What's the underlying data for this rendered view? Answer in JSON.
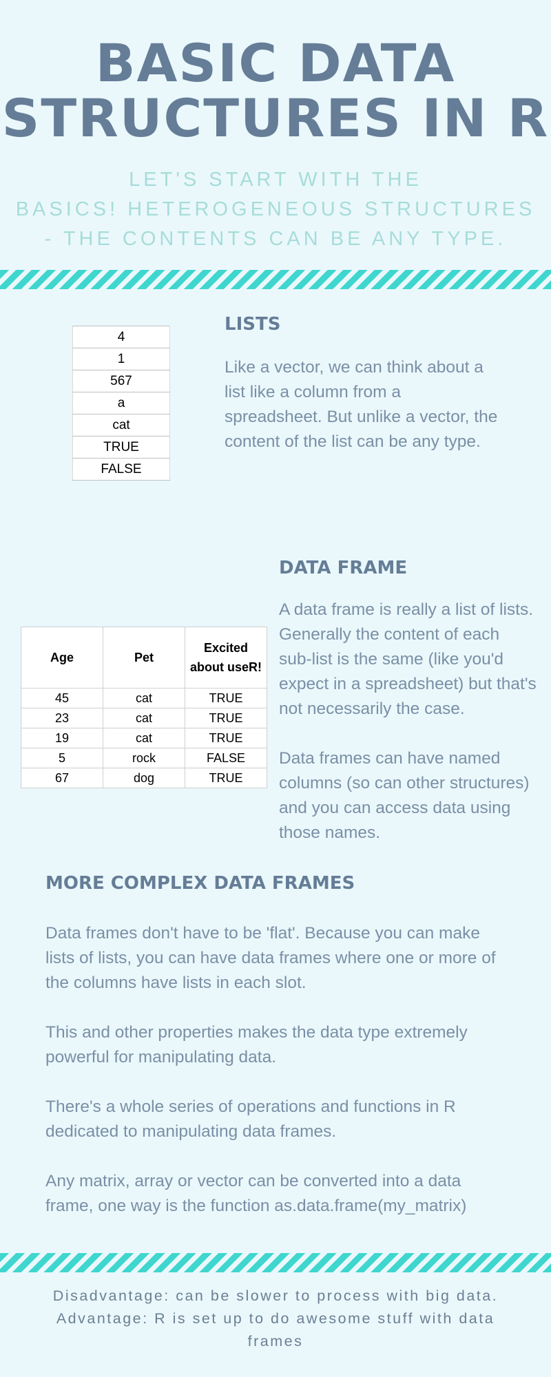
{
  "header": {
    "title_line1": "BASIC DATA",
    "title_line2": "STRUCTURES IN R",
    "subtitle_line1": "LET'S START WITH THE",
    "subtitle_line2": "BASICS! HETEROGENEOUS STRUCTURES",
    "subtitle_line3": "- THE CONTENTS CAN BE ANY TYPE."
  },
  "lists": {
    "heading": "LISTS",
    "table_values": [
      "4",
      "1",
      "567",
      "a",
      "cat",
      "TRUE",
      "FALSE"
    ],
    "text_lines": [
      "Like a vector, we can think about a",
      "list like a column from a",
      "spreadsheet. But unlike a vector, the",
      "content of the list can be any type."
    ]
  },
  "data_frame": {
    "heading": "DATA FRAME",
    "table_headers": [
      "Age",
      "Pet",
      "Excited about useR!"
    ],
    "table_rows": [
      [
        "45",
        "cat",
        "TRUE"
      ],
      [
        "23",
        "cat",
        "TRUE"
      ],
      [
        "19",
        "cat",
        "TRUE"
      ],
      [
        "5",
        "rock",
        "FALSE"
      ],
      [
        "67",
        "dog",
        "TRUE"
      ]
    ],
    "para1_lines": [
      "A data frame is really a list of lists.",
      "Generally the content of each",
      "sub-list is the same (like you'd",
      "expect in a spreadsheet) but that's",
      "not necessarily the case."
    ],
    "para2_lines": [
      "Data frames can have named",
      "columns (so can other structures)",
      "and you can access data using",
      "those names."
    ]
  },
  "complex": {
    "heading": "MORE COMPLEX DATA FRAMES",
    "para1_lines": [
      "Data frames don't have to be 'flat'. Because you can make",
      "lists of lists, you can have data frames where one or more of",
      "the columns have lists in each slot."
    ],
    "para2_lines": [
      "This and other properties makes the data type extremely",
      "powerful for manipulating data."
    ],
    "para3_lines": [
      "There's a whole series of operations and functions in R",
      "dedicated to manipulating data frames."
    ],
    "para4_lines": [
      "Any matrix, array or vector can be converted into a data",
      "frame, one way is the function as.data.frame(my_matrix)"
    ]
  },
  "footer": {
    "line1": "Disadvantage: can be slower to process with big data.",
    "line2": "Advantage: R is set up to do awesome stuff with data",
    "line3": "frames"
  },
  "colors": {
    "background": "#eaf8fc",
    "heading": "#657d96",
    "subtitle": "#a7dcd9",
    "stripe": "#3fd6ce",
    "body_text": "#7b8fa5"
  }
}
